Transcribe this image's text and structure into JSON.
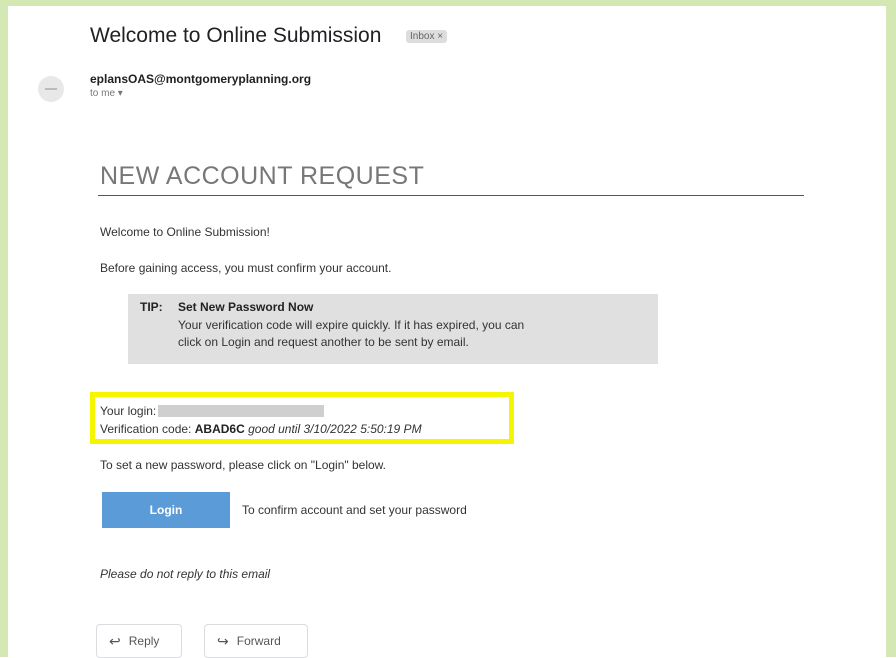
{
  "email": {
    "subject": "Welcome to Online Submission",
    "label_badge": "Inbox ×",
    "sender": "eplansOAS@montgomeryplanning.org",
    "recipient": "to me ▾"
  },
  "body": {
    "heading": "NEW ACCOUNT REQUEST",
    "welcome": "Welcome to Online Submission!",
    "confirm_notice": "Before gaining access, you must confirm your account.",
    "tip": {
      "label": "TIP:",
      "title": "Set New Password Now",
      "line1": "Your verification code will expire quickly. If it has expired, you can",
      "line2": "click on Login and request another to be sent by email."
    },
    "login_label": "Your login:",
    "verification_label": "Verification code:",
    "verification_code": "ABAD6C",
    "valid_until": "good until 3/10/2022 5:50:19 PM",
    "set_password_instruction": "To set a new password, please click on \"Login\" below.",
    "login_button": "Login",
    "login_button_desc": "To confirm account and set your password",
    "no_reply": "Please do not reply to this email"
  },
  "actions": {
    "reply": "Reply",
    "forward": "Forward"
  },
  "colors": {
    "frame_border": "#d4e8b4",
    "highlight": "#f5f500",
    "login_button": "#5b9bd8",
    "tip_background": "#e0e0e0"
  }
}
